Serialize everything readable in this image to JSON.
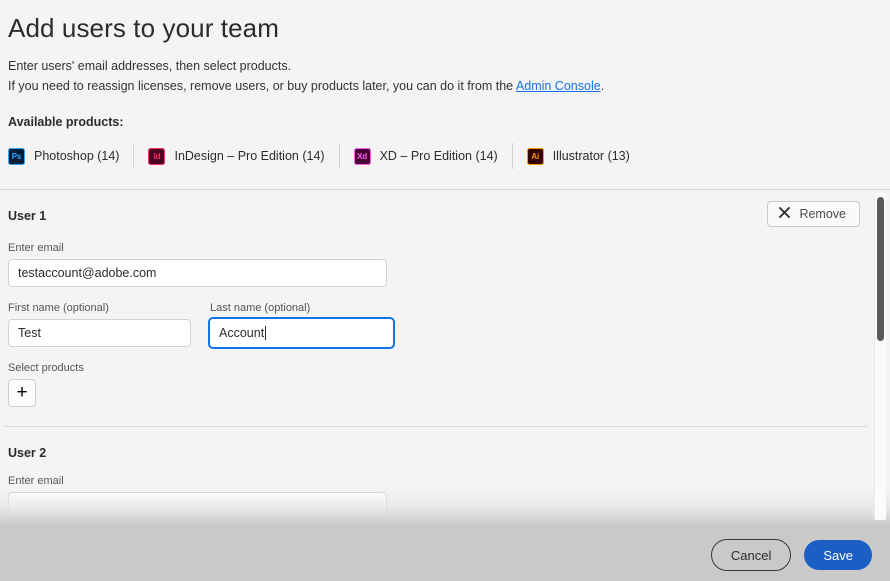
{
  "header": {
    "title": "Add users to your team",
    "intro_line1": "Enter users' email addresses, then select products.",
    "intro_line2_before": "If you need to reassign licenses, remove users, or buy products later, you can do it from the ",
    "intro_link": "Admin Console",
    "intro_line2_after": ".",
    "available_products_label": "Available products:"
  },
  "products": [
    {
      "abbr": "Ps",
      "name": "Photoshop (14)",
      "bg": "#001e36",
      "fg": "#31a8ff",
      "border": "#31a8ff"
    },
    {
      "abbr": "Id",
      "name": "InDesign – Pro Edition (14)",
      "bg": "#49021f",
      "fg": "#ff3366",
      "border": "#ff3366"
    },
    {
      "abbr": "Xd",
      "name": "XD – Pro Edition (14)",
      "bg": "#470137",
      "fg": "#ff61f6",
      "border": "#ff61f6"
    },
    {
      "abbr": "Ai",
      "name": "Illustrator (13)",
      "bg": "#330000",
      "fg": "#ff9a00",
      "border": "#ff9a00"
    }
  ],
  "users": [
    {
      "title": "User 1",
      "remove_label": "Remove",
      "email_label": "Enter email",
      "email_value": "testaccount@adobe.com",
      "email_placeholder": "",
      "first_name_label": "First name (optional)",
      "first_name_value": "Test",
      "last_name_label": "Last name (optional)",
      "last_name_value": "Account",
      "select_products_label": "Select products",
      "add_product_glyph": "+"
    },
    {
      "title": "User 2",
      "email_label": "Enter email",
      "email_value": "",
      "email_placeholder": ""
    }
  ],
  "footer": {
    "cancel_label": "Cancel",
    "save_label": "Save"
  },
  "colors": {
    "accent_blue": "#1473e6",
    "save_blue": "#1c5fc4",
    "page_bg": "#f4f4f4",
    "footer_bg": "#c9c9c9"
  }
}
